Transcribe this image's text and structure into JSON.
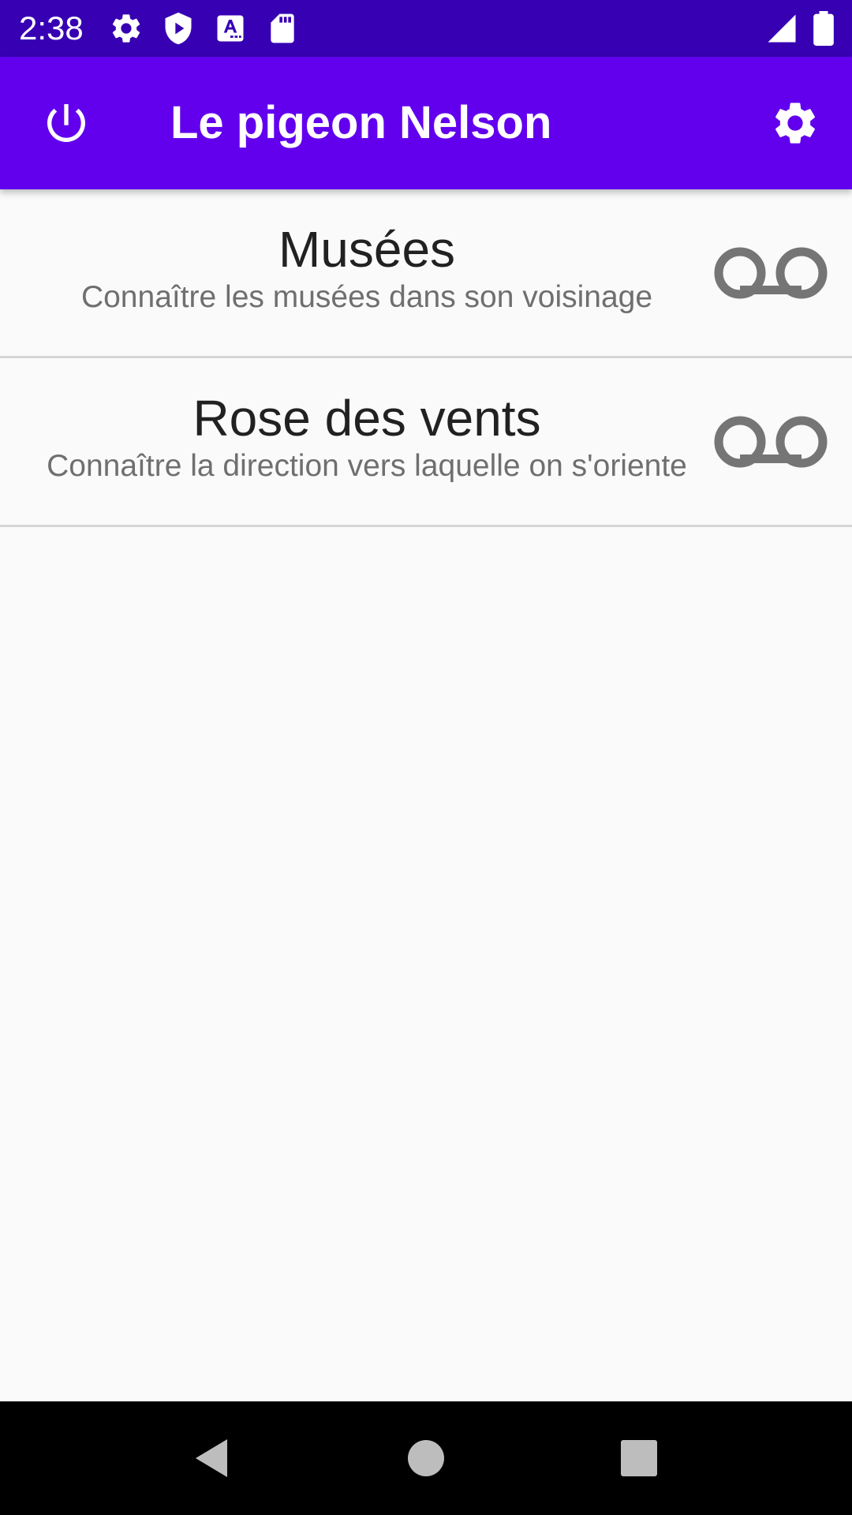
{
  "status_bar": {
    "time": "2:38",
    "icons": [
      "settings-icon",
      "play-protect-icon",
      "text-input-icon",
      "sd-card-icon",
      "cell-signal-icon",
      "battery-icon"
    ]
  },
  "app_bar": {
    "title": "Le pigeon Nelson",
    "left_icon": "power-icon",
    "right_icon": "gear-icon"
  },
  "list": {
    "items": [
      {
        "title": "Musées",
        "subtitle": "Connaître les musées dans son voisinage",
        "icon": "voicemail-icon"
      },
      {
        "title": "Rose des vents",
        "subtitle": "Connaître la direction vers laquelle on s'oriente",
        "icon": "voicemail-icon"
      }
    ]
  },
  "nav_bar": {
    "buttons": [
      "back-icon",
      "home-icon",
      "recents-icon"
    ]
  },
  "colors": {
    "status_bar": "#3700b3",
    "app_bar": "#6200ee",
    "background": "#fafafa",
    "row_title": "#212121",
    "row_subtitle": "#6f6f6f",
    "row_icon": "#757575",
    "divider": "#d6d6d6"
  }
}
